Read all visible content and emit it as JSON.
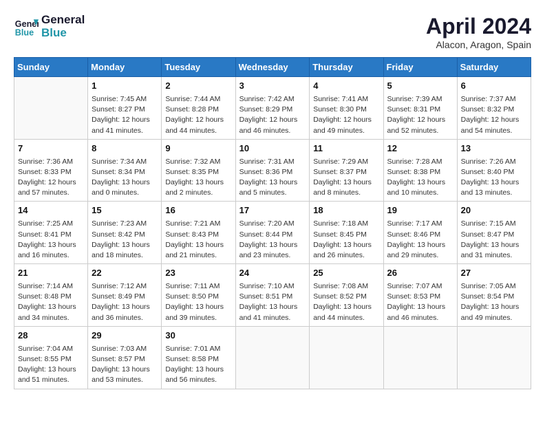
{
  "header": {
    "logo_line1": "General",
    "logo_line2": "Blue",
    "month_title": "April 2024",
    "location": "Alacon, Aragon, Spain"
  },
  "weekdays": [
    "Sunday",
    "Monday",
    "Tuesday",
    "Wednesday",
    "Thursday",
    "Friday",
    "Saturday"
  ],
  "weeks": [
    [
      {
        "num": "",
        "data": ""
      },
      {
        "num": "1",
        "data": "Sunrise: 7:45 AM\nSunset: 8:27 PM\nDaylight: 12 hours\nand 41 minutes."
      },
      {
        "num": "2",
        "data": "Sunrise: 7:44 AM\nSunset: 8:28 PM\nDaylight: 12 hours\nand 44 minutes."
      },
      {
        "num": "3",
        "data": "Sunrise: 7:42 AM\nSunset: 8:29 PM\nDaylight: 12 hours\nand 46 minutes."
      },
      {
        "num": "4",
        "data": "Sunrise: 7:41 AM\nSunset: 8:30 PM\nDaylight: 12 hours\nand 49 minutes."
      },
      {
        "num": "5",
        "data": "Sunrise: 7:39 AM\nSunset: 8:31 PM\nDaylight: 12 hours\nand 52 minutes."
      },
      {
        "num": "6",
        "data": "Sunrise: 7:37 AM\nSunset: 8:32 PM\nDaylight: 12 hours\nand 54 minutes."
      }
    ],
    [
      {
        "num": "7",
        "data": "Sunrise: 7:36 AM\nSunset: 8:33 PM\nDaylight: 12 hours\nand 57 minutes."
      },
      {
        "num": "8",
        "data": "Sunrise: 7:34 AM\nSunset: 8:34 PM\nDaylight: 13 hours\nand 0 minutes."
      },
      {
        "num": "9",
        "data": "Sunrise: 7:32 AM\nSunset: 8:35 PM\nDaylight: 13 hours\nand 2 minutes."
      },
      {
        "num": "10",
        "data": "Sunrise: 7:31 AM\nSunset: 8:36 PM\nDaylight: 13 hours\nand 5 minutes."
      },
      {
        "num": "11",
        "data": "Sunrise: 7:29 AM\nSunset: 8:37 PM\nDaylight: 13 hours\nand 8 minutes."
      },
      {
        "num": "12",
        "data": "Sunrise: 7:28 AM\nSunset: 8:38 PM\nDaylight: 13 hours\nand 10 minutes."
      },
      {
        "num": "13",
        "data": "Sunrise: 7:26 AM\nSunset: 8:40 PM\nDaylight: 13 hours\nand 13 minutes."
      }
    ],
    [
      {
        "num": "14",
        "data": "Sunrise: 7:25 AM\nSunset: 8:41 PM\nDaylight: 13 hours\nand 16 minutes."
      },
      {
        "num": "15",
        "data": "Sunrise: 7:23 AM\nSunset: 8:42 PM\nDaylight: 13 hours\nand 18 minutes."
      },
      {
        "num": "16",
        "data": "Sunrise: 7:21 AM\nSunset: 8:43 PM\nDaylight: 13 hours\nand 21 minutes."
      },
      {
        "num": "17",
        "data": "Sunrise: 7:20 AM\nSunset: 8:44 PM\nDaylight: 13 hours\nand 23 minutes."
      },
      {
        "num": "18",
        "data": "Sunrise: 7:18 AM\nSunset: 8:45 PM\nDaylight: 13 hours\nand 26 minutes."
      },
      {
        "num": "19",
        "data": "Sunrise: 7:17 AM\nSunset: 8:46 PM\nDaylight: 13 hours\nand 29 minutes."
      },
      {
        "num": "20",
        "data": "Sunrise: 7:15 AM\nSunset: 8:47 PM\nDaylight: 13 hours\nand 31 minutes."
      }
    ],
    [
      {
        "num": "21",
        "data": "Sunrise: 7:14 AM\nSunset: 8:48 PM\nDaylight: 13 hours\nand 34 minutes."
      },
      {
        "num": "22",
        "data": "Sunrise: 7:12 AM\nSunset: 8:49 PM\nDaylight: 13 hours\nand 36 minutes."
      },
      {
        "num": "23",
        "data": "Sunrise: 7:11 AM\nSunset: 8:50 PM\nDaylight: 13 hours\nand 39 minutes."
      },
      {
        "num": "24",
        "data": "Sunrise: 7:10 AM\nSunset: 8:51 PM\nDaylight: 13 hours\nand 41 minutes."
      },
      {
        "num": "25",
        "data": "Sunrise: 7:08 AM\nSunset: 8:52 PM\nDaylight: 13 hours\nand 44 minutes."
      },
      {
        "num": "26",
        "data": "Sunrise: 7:07 AM\nSunset: 8:53 PM\nDaylight: 13 hours\nand 46 minutes."
      },
      {
        "num": "27",
        "data": "Sunrise: 7:05 AM\nSunset: 8:54 PM\nDaylight: 13 hours\nand 49 minutes."
      }
    ],
    [
      {
        "num": "28",
        "data": "Sunrise: 7:04 AM\nSunset: 8:55 PM\nDaylight: 13 hours\nand 51 minutes."
      },
      {
        "num": "29",
        "data": "Sunrise: 7:03 AM\nSunset: 8:57 PM\nDaylight: 13 hours\nand 53 minutes."
      },
      {
        "num": "30",
        "data": "Sunrise: 7:01 AM\nSunset: 8:58 PM\nDaylight: 13 hours\nand 56 minutes."
      },
      {
        "num": "",
        "data": ""
      },
      {
        "num": "",
        "data": ""
      },
      {
        "num": "",
        "data": ""
      },
      {
        "num": "",
        "data": ""
      }
    ]
  ]
}
